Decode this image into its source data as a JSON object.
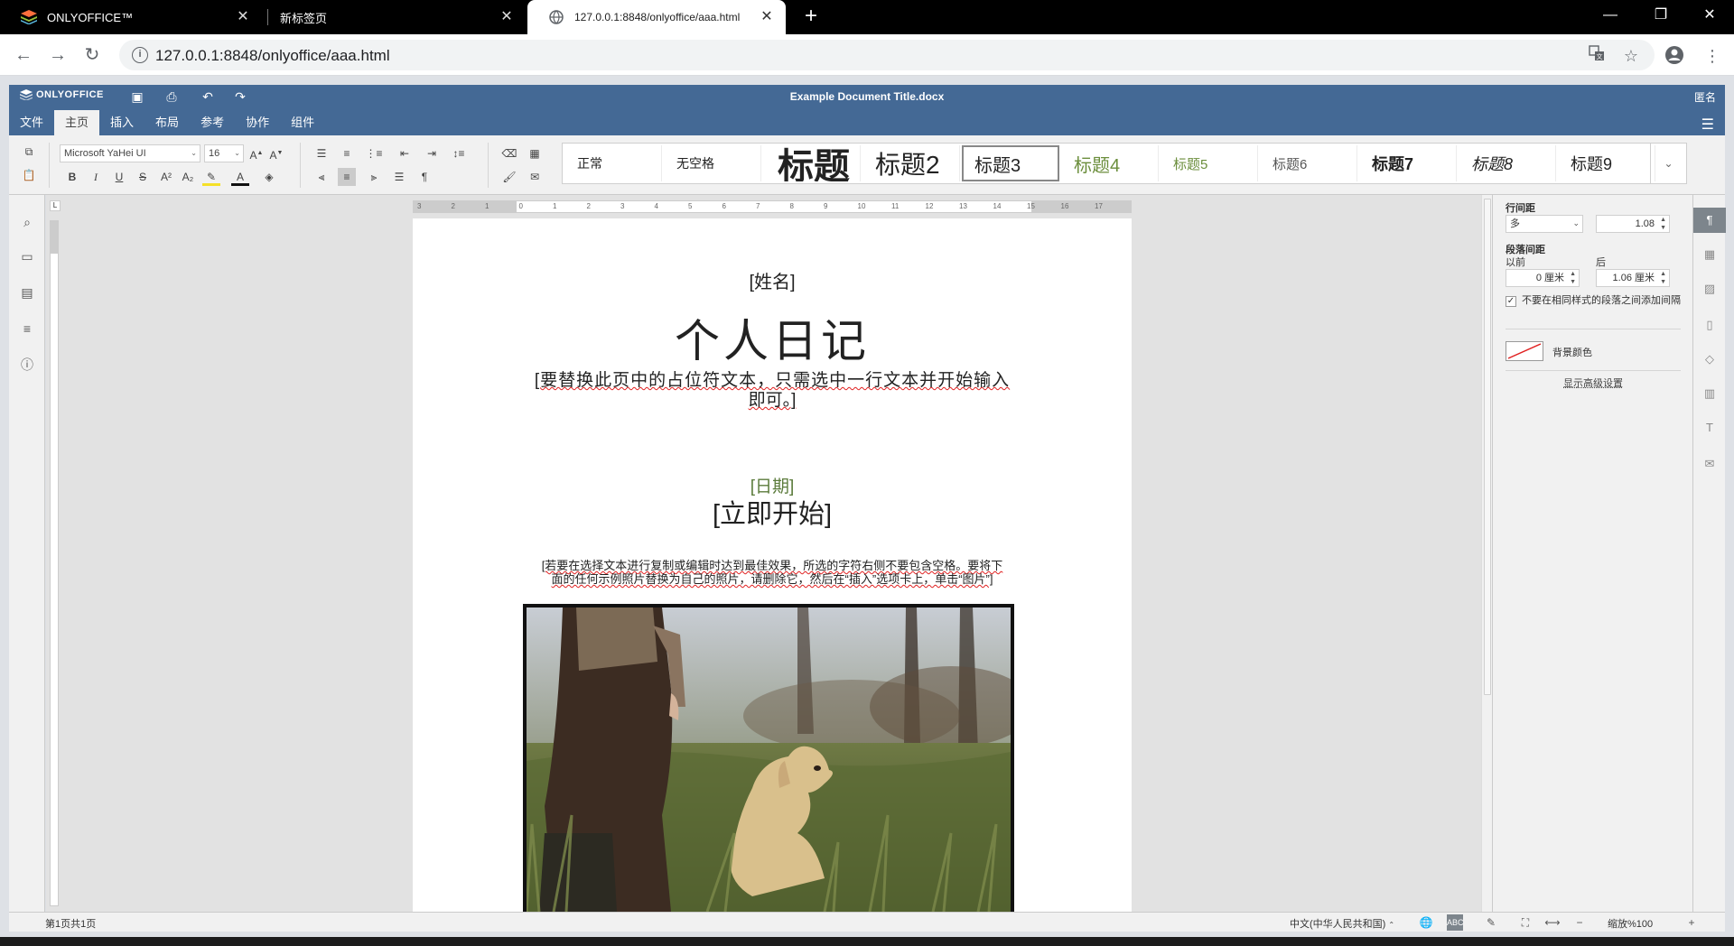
{
  "browser": {
    "tabs": [
      {
        "label": "ONLYOFFICE™",
        "active": false
      },
      {
        "label": "新标签页",
        "active": false
      },
      {
        "label": "127.0.0.1:8848/onlyoffice/aaa.html",
        "active": true
      }
    ],
    "new_tab": "+",
    "url": "127.0.0.1:8848/onlyoffice/aaa.html"
  },
  "editor": {
    "brand": "ONLYOFFICE",
    "doc_title": "Example Document Title.docx",
    "user": "匿名",
    "menu_tabs": [
      "文件",
      "主页",
      "插入",
      "布局",
      "参考",
      "协作",
      "组件"
    ],
    "active_tab": "主页"
  },
  "toolbar": {
    "font_name": "Microsoft YaHei UI",
    "font_size": "16",
    "styles": [
      "正常",
      "无空格",
      "标题",
      "标题2",
      "标题3",
      "标题4",
      "标题5",
      "标题6",
      "标题7",
      "标题8",
      "标题9"
    ],
    "selected_style": "标题3"
  },
  "document": {
    "name_placeholder": "[姓名]",
    "title": "个人日记",
    "intro_line1": "[要替换此页中的占位符文本，只需选中一行文本并开始输入",
    "intro_line2": "即可。]",
    "date_placeholder": "[日期]",
    "start_now": "[立即开始]",
    "note_line1": "[若要在选择文本进行复制或编辑时达到最佳效果，所选的字符右侧不要包含空格。要将下",
    "note_line2": "面的任何示例照片替换为自己的照片，请删除它，然后在“插入”选项卡上，单击“图片”]"
  },
  "paragraph_settings": {
    "line_spacing_label": "行间距",
    "line_spacing_mode": "多",
    "line_spacing_value": "1.08",
    "para_spacing_label": "段落间距",
    "before_label": "以前",
    "after_label": "后",
    "before_value": "0 厘米",
    "after_value": "1.06 厘米",
    "no_space_same_style": "不要在相同样式的段落之间添加间隔",
    "no_space_checked": true,
    "background_color": "背景颜色",
    "advanced_settings": "显示高级设置"
  },
  "status": {
    "page_info": "第1页共1页",
    "language": "中文(中华人民共和国)",
    "zoom": "缩放%100"
  },
  "colors": {
    "header_blue": "#446995",
    "date_green": "#5b7b3b",
    "heading4_green": "#6b8e3c",
    "spellcheck_red": "#e02020"
  }
}
